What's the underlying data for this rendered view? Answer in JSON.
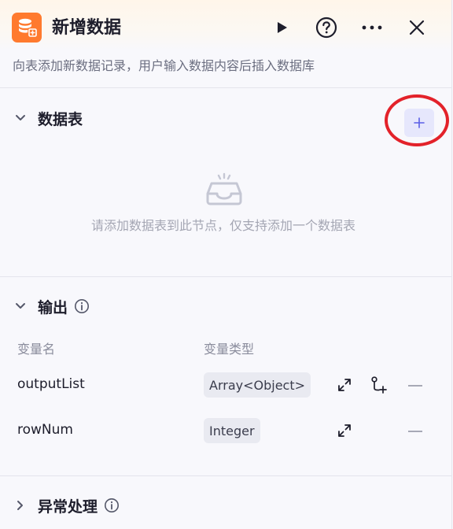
{
  "node": {
    "title": "新增数据",
    "description": "向表添加新数据记录，用户输入数据内容后插入数据库",
    "icon": "database-add-icon",
    "brand_color": "#ff7a2e"
  },
  "header_actions": [
    {
      "name": "run-button",
      "icon": "play-icon"
    },
    {
      "name": "help-button",
      "icon": "question-circle-icon"
    },
    {
      "name": "more-button",
      "icon": "ellipsis-icon"
    },
    {
      "name": "close-button",
      "icon": "close-icon"
    }
  ],
  "table_section": {
    "title": "数据表",
    "add_icon": "plus-icon",
    "empty_icon": "inbox-icon",
    "empty_text": "请添加数据表到此节点，仅支持添加一个数据表"
  },
  "output_section": {
    "title": "输出",
    "columns": {
      "name": "变量名",
      "type": "变量类型"
    },
    "rows": [
      {
        "name": "outputList",
        "type": "Array<Object>",
        "actions": [
          "expand-icon",
          "add-child-icon",
          "remove-icon"
        ]
      },
      {
        "name": "rowNum",
        "type": "Integer",
        "actions": [
          "expand-icon",
          "remove-icon"
        ]
      }
    ]
  },
  "exception_section": {
    "title": "异常处理"
  },
  "colors": {
    "accent": "#5a5fe6",
    "add_button_bg": "#e6e7fc",
    "highlight_ring": "#e3222a",
    "muted_text": "#a4a6b3"
  }
}
